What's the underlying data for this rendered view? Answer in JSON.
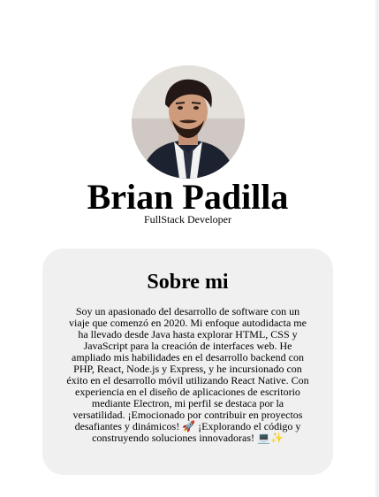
{
  "profile": {
    "name": "Brian Padilla",
    "role": "FullStack Developer",
    "avatar_alt": "Brian Padilla profile photo"
  },
  "about": {
    "title": "Sobre mi",
    "text": "Soy un apasionado del desarrollo de software con un viaje que comenzó en 2020. Mi enfoque autodidacta me ha llevado desde Java hasta explorar HTML, CSS y JavaScript para la creación de interfaces web. He ampliado mis habilidades en el desarrollo backend con PHP, React, Node.js y Express, y he incursionado con éxito en el desarrollo móvil utilizando React Native. Con experiencia en el diseño de aplicaciones de escritorio mediante Electron, mi perfil se destaca por la versatilidad. ¡Emocionado por contribuir en proyectos desafiantes y dinámicos! 🚀 ¡Explorando el código y construyendo soluciones innovadoras! 💻✨"
  },
  "colors": {
    "page_bg": "#ffffff",
    "card_bg": "#f0f0f0",
    "text": "#000000"
  }
}
